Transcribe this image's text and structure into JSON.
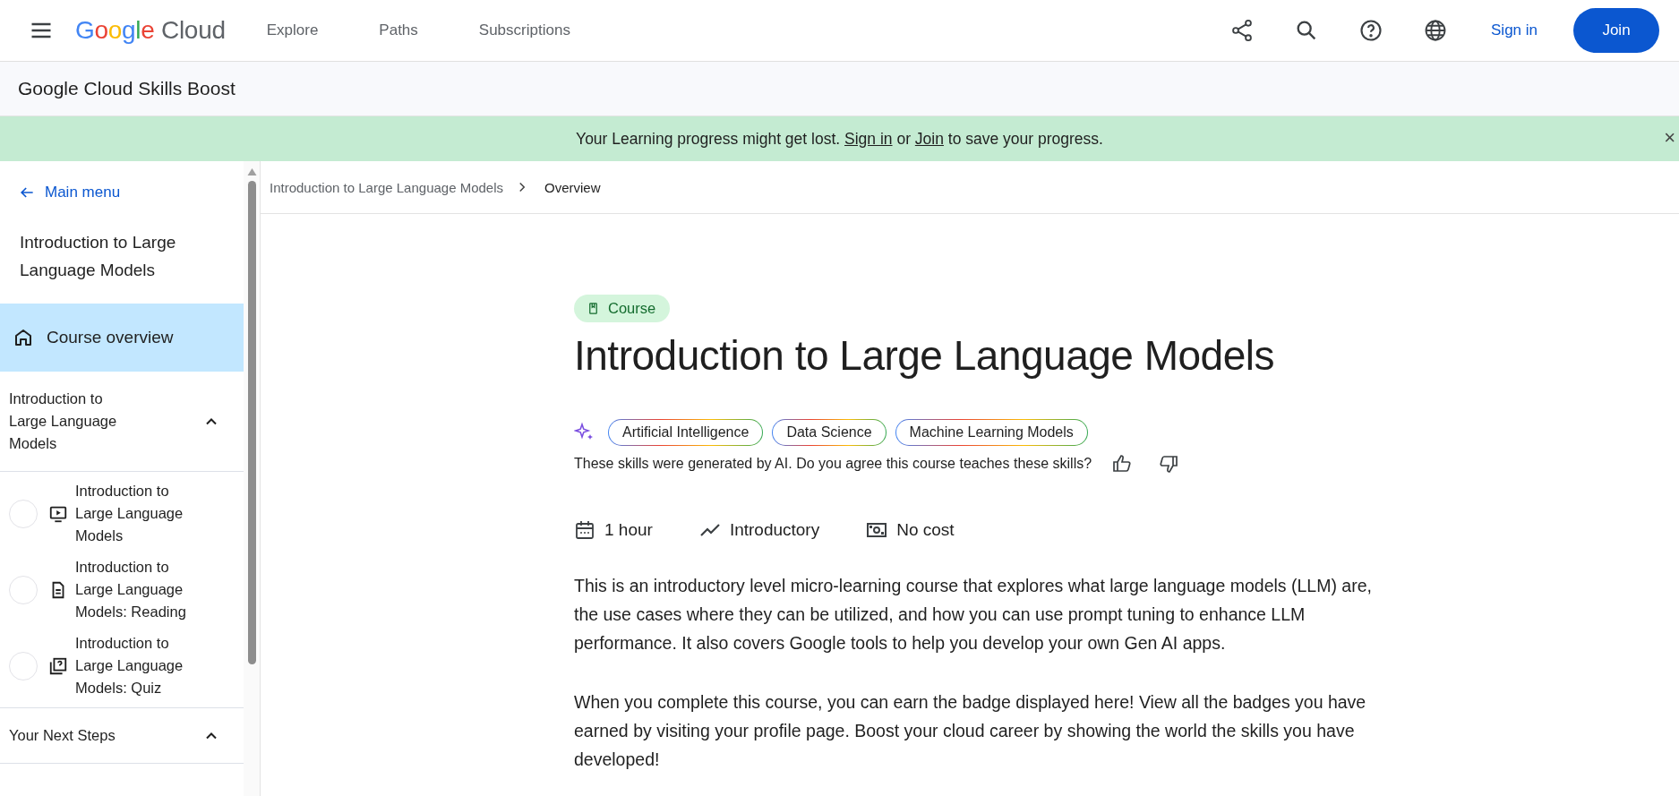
{
  "header": {
    "logo": "Google Cloud",
    "nav": [
      {
        "label": "Explore"
      },
      {
        "label": "Paths"
      },
      {
        "label": "Subscriptions"
      }
    ],
    "sign_in": "Sign in",
    "join": "Join"
  },
  "subheader": {
    "title": "Google Cloud Skills Boost"
  },
  "banner": {
    "before": "Your Learning progress might get lost.",
    "sign_in": "Sign in",
    "middle": "or",
    "join": "Join",
    "after": "to save your progress.",
    "close": "×"
  },
  "sidebar": {
    "back": "Main menu",
    "course_title": "Introduction to Large Language Models",
    "overview": {
      "label": "Course overview",
      "selected": true
    },
    "sections": [
      {
        "title": "Introduction to Large Language Models",
        "expanded": true,
        "items": [
          {
            "kind": "video",
            "label": "Introduction to Large Language Models",
            "completed": false
          },
          {
            "kind": "reading",
            "label": "Introduction to Large Language Models: Reading",
            "completed": false
          },
          {
            "kind": "quiz",
            "label": "Introduction to Large Language Models: Quiz",
            "completed": false
          }
        ]
      },
      {
        "title": "Your Next Steps",
        "expanded": true
      }
    ]
  },
  "breadcrumb": [
    {
      "label": "Introduction to Large Language Models",
      "selected": false
    },
    {
      "label": "Overview",
      "selected": true
    }
  ],
  "course": {
    "type_badge": "Course",
    "title": "Introduction to Large Language Models",
    "skills": [
      "Artificial Intelligence",
      "Data Science",
      "Machine Learning Models"
    ],
    "skills_note": "These skills were generated by AI. Do you agree this course teaches these skills?",
    "facts": [
      {
        "kind": "duration",
        "text": "1 hour"
      },
      {
        "kind": "level",
        "text": "Introductory"
      },
      {
        "kind": "cost",
        "text": "No cost"
      }
    ],
    "paragraphs": [
      "This is an introductory level micro-learning course that explores what large language models (LLM) are, the use cases where they can be utilized, and how you can use prompt tuning to enhance LLM performance. It also covers Google tools to help you develop your own Gen AI apps.",
      "When you complete this course, you can earn the badge displayed here! View all the badges you have earned by visiting your profile page. Boost your cloud career by showing the world the skills you have developed!"
    ]
  }
}
